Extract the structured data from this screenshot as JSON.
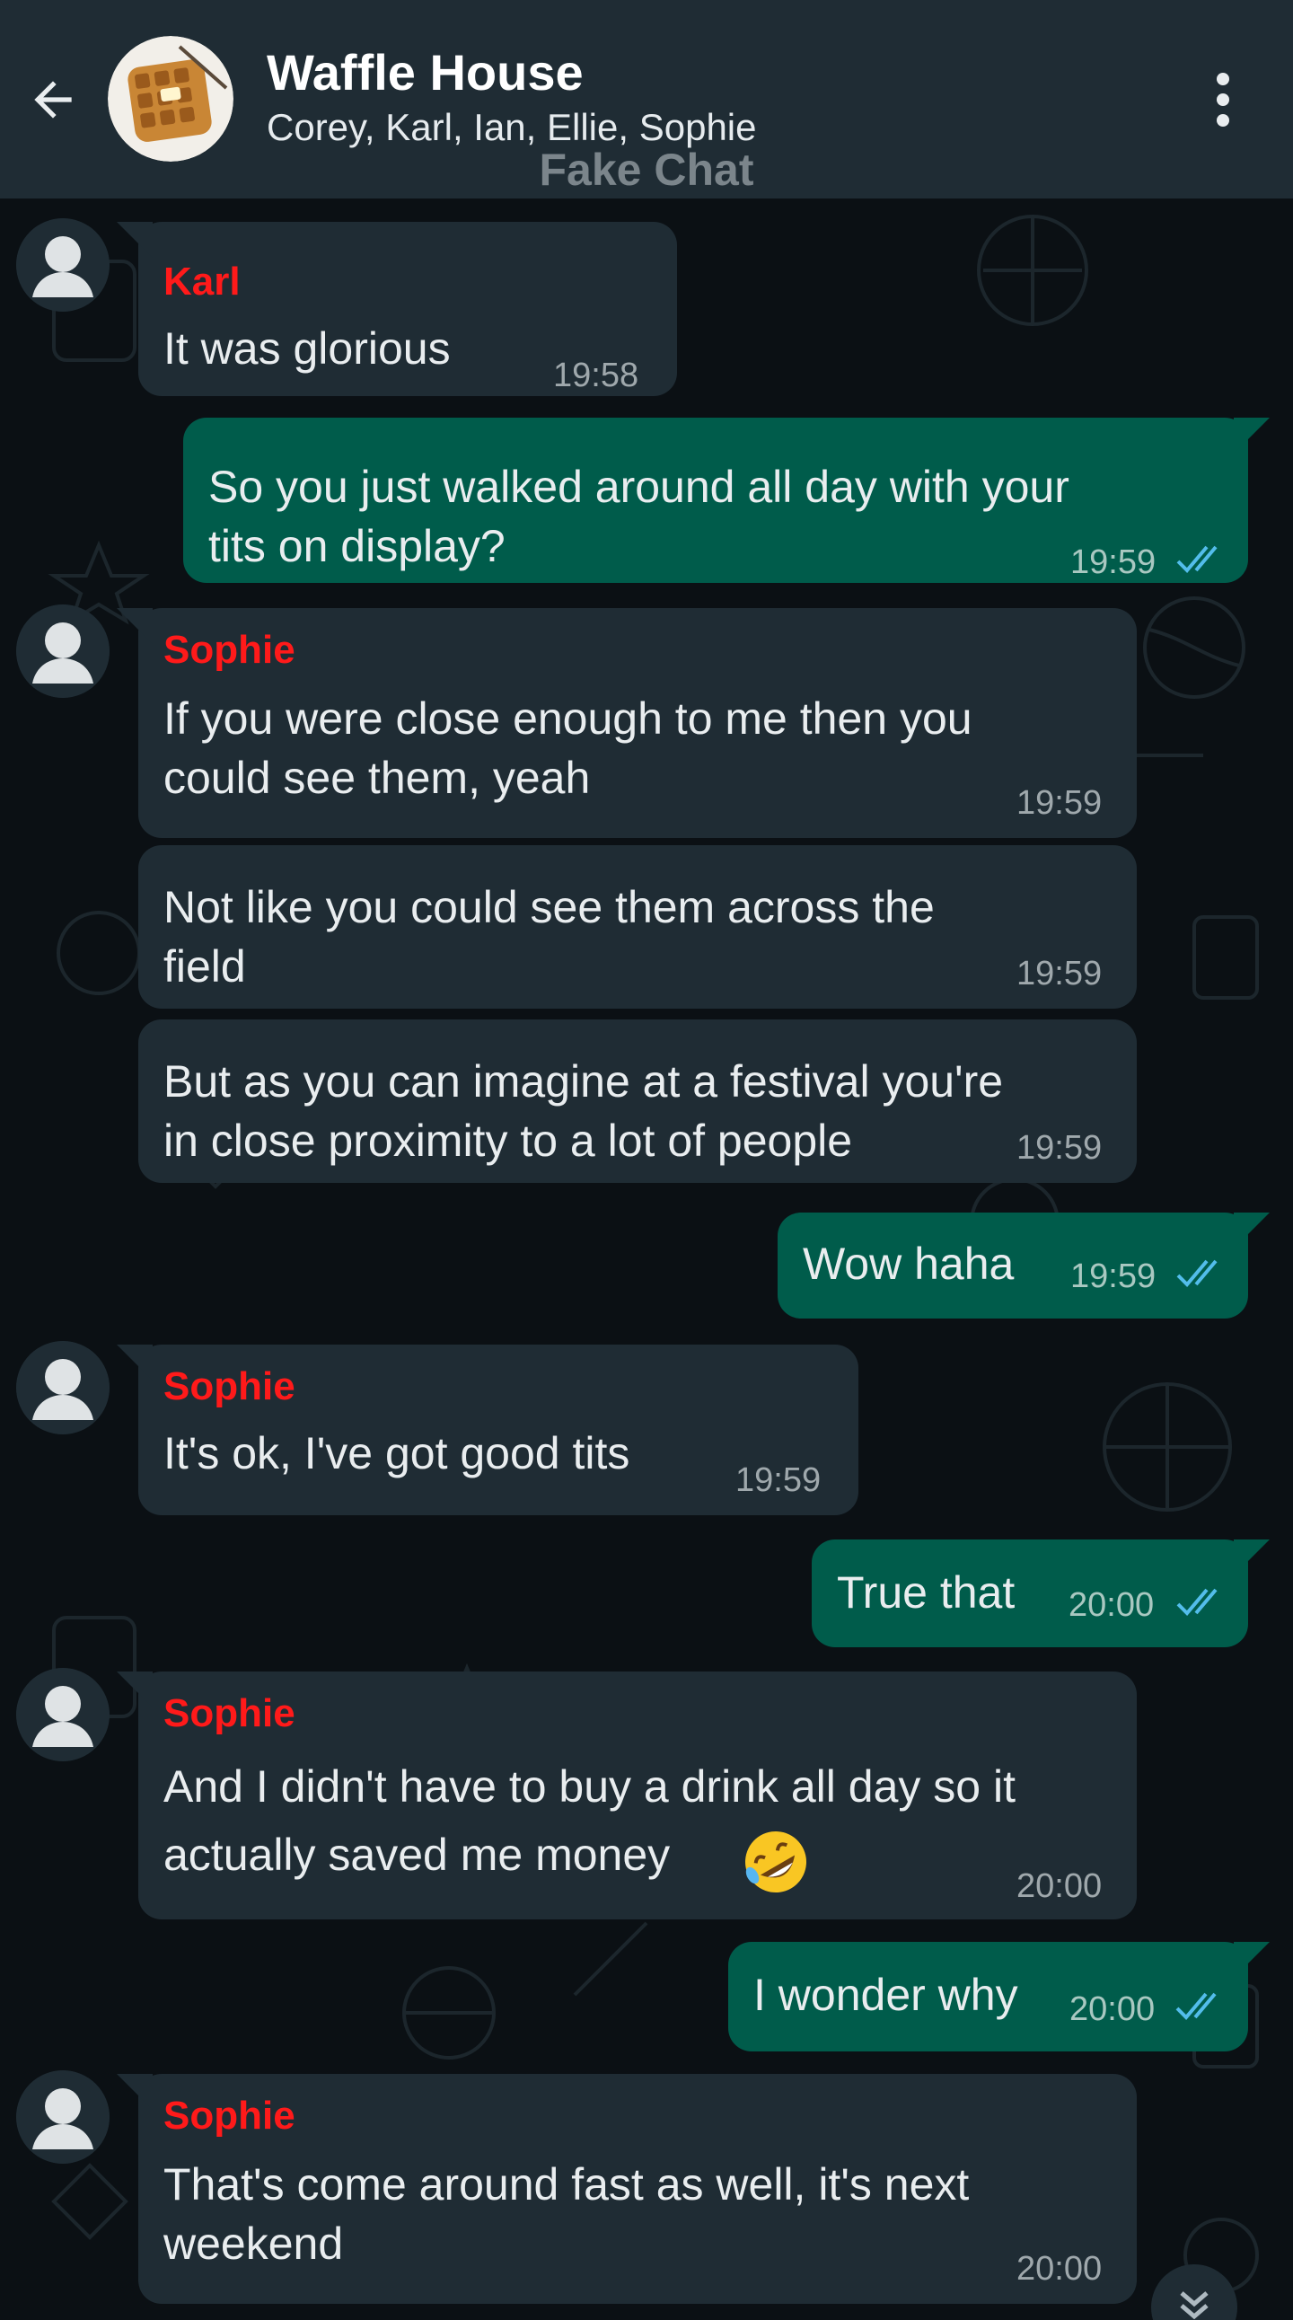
{
  "header": {
    "back_icon": "arrow-left-icon",
    "group_name": "Waffle House",
    "members": "Corey, Karl, Ian, Ellie, Sophie",
    "watermark": "Fake Chat",
    "menu_icon": "more-vertical-icon"
  },
  "colors": {
    "header_bg": "#1f2c34",
    "chat_bg": "#0b1014",
    "incoming_bubble": "#1f2c34",
    "outgoing_bubble": "#005c4b",
    "sender_name": "#ff1a1a",
    "read_ticks": "#53bdeb"
  },
  "messages": [
    {
      "sender": "Karl",
      "text": "It was glorious",
      "time": "19:58"
    },
    {
      "text": "So you just walked around all day with your\ntits on display?",
      "time": "19:59"
    },
    {
      "sender": "Sophie",
      "text": "If you were close enough to me then you\ncould see them, yeah",
      "time": "19:59"
    },
    {
      "text": "Not like you could see them across the\nfield",
      "time": "19:59"
    },
    {
      "text": "But as you can imagine at a festival you're\nin close proximity to a lot of people",
      "time": "19:59"
    },
    {
      "text": "Wow haha",
      "time": "19:59"
    },
    {
      "sender": "Sophie",
      "text": "It's ok, I've got good tits",
      "time": "19:59"
    },
    {
      "text": "True that",
      "time": "20:00"
    },
    {
      "sender": "Sophie",
      "text": "And I didn't have to buy a drink all day so it\nactually saved me money",
      "emoji": "rolling-on-floor-laughing-emoji",
      "time": "20:00"
    },
    {
      "text": "I wonder why",
      "time": "20:00"
    },
    {
      "sender": "Sophie",
      "text": "That's come around fast as well, it's next\nweekend",
      "time": "20:00"
    }
  ],
  "scroll_down_icon": "double-chevron-down-icon"
}
